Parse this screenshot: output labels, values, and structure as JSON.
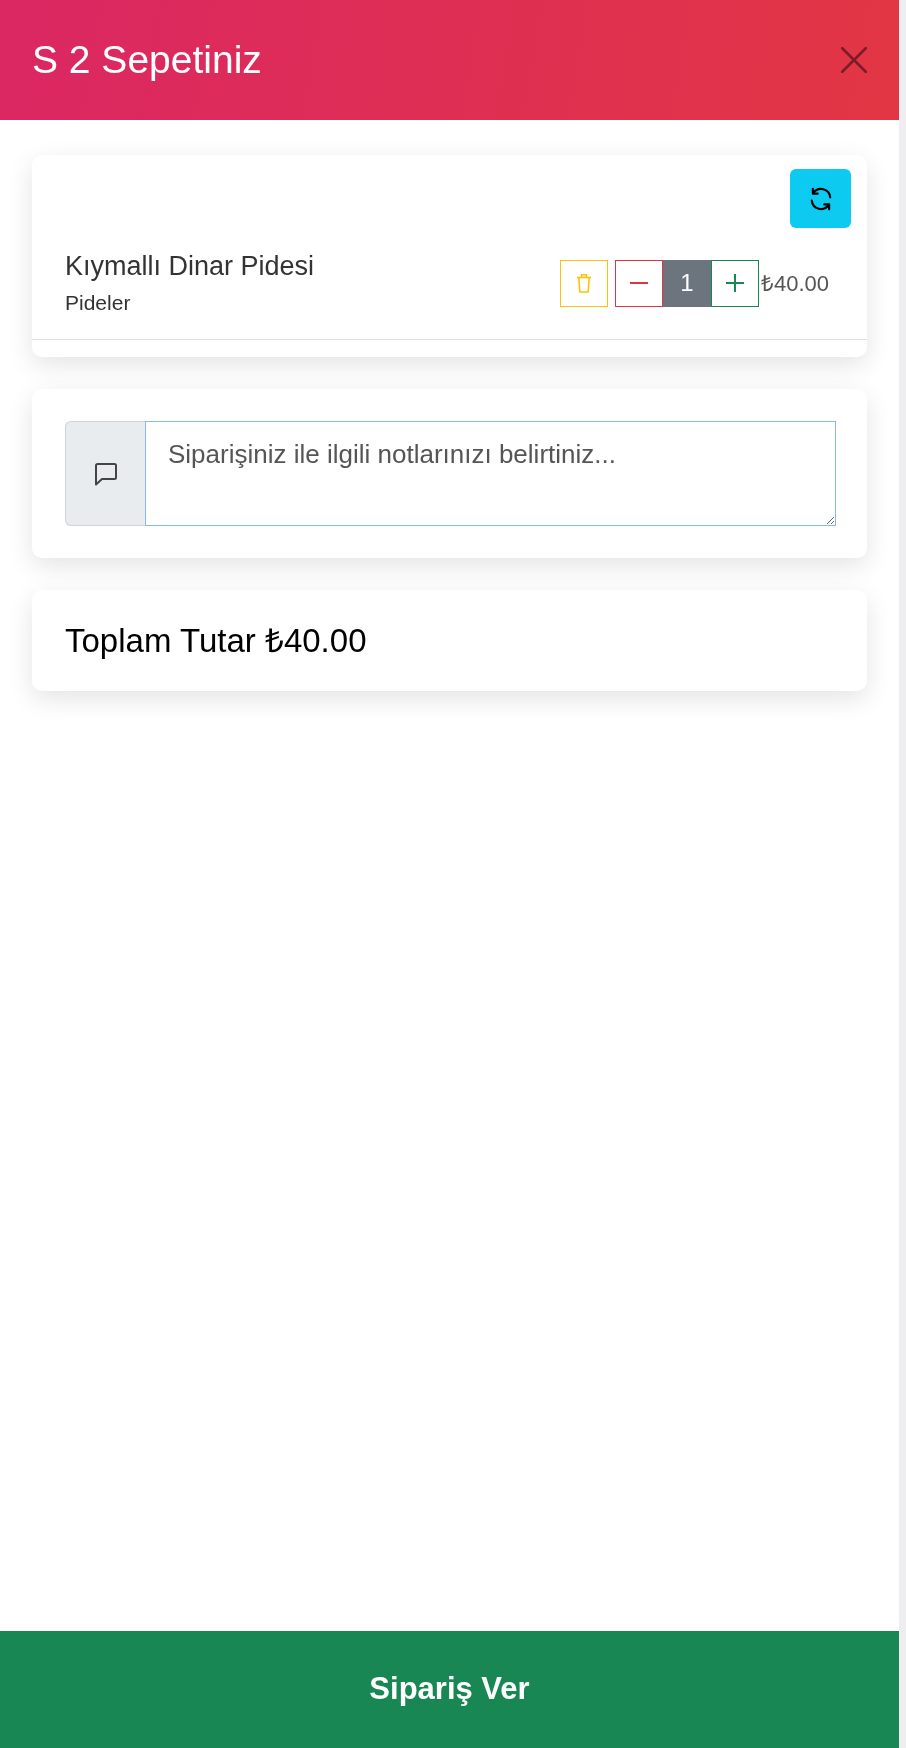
{
  "header": {
    "title": "S 2 Sepetiniz"
  },
  "cart_items": [
    {
      "name": "Kıymallı Dinar Pidesi",
      "category": "Pideler",
      "quantity": "1",
      "price": "₺40.00"
    }
  ],
  "notes": {
    "placeholder": "Siparişiniz ile ilgili notlarınızı belirtiniz...",
    "focused": true
  },
  "total": "Toplam Tutar ₺40.00",
  "submit_button": "Sipariş Ver"
}
